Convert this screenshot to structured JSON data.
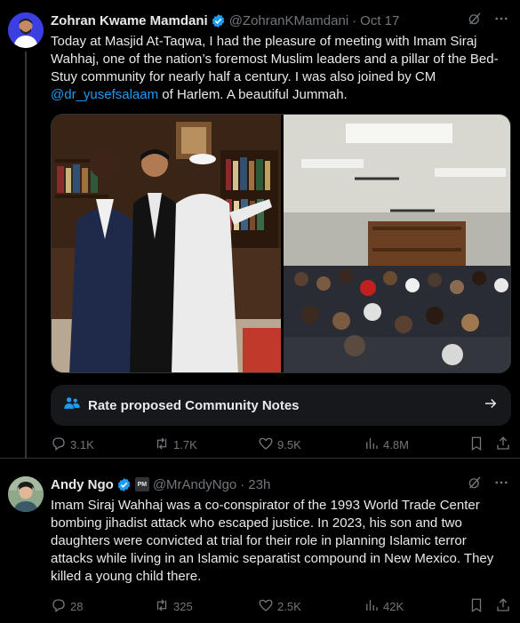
{
  "posts": [
    {
      "author_name": "Zohran Kwame Mamdani",
      "handle": "@ZohranKMamdani",
      "dot": "·",
      "time": "Oct 17",
      "text_before": "Today at Masjid At-Taqwa, I had the pleasure of meeting with Imam Siraj Wahhaj, one of the nation’s foremost Muslim leaders and a pillar of the Bed-Stuy community for nearly half a century. I was also joined by CM ",
      "mention": "@dr_yusefsalaam",
      "text_after": " of Harlem. A beautiful Jummah.",
      "community_notes_label": "Rate proposed Community Notes",
      "replies": "3.1K",
      "reposts": "1.7K",
      "likes": "9.5K",
      "views": "4.8M"
    },
    {
      "author_name": "Andy Ngo",
      "affiliate_badge": "PM",
      "handle": "@MrAndyNgo",
      "dot": "·",
      "time": "23h",
      "text": "Imam Siraj Wahhaj was a co-conspirator of the 1993 World Trade Center bombing jihadist attack who escaped justice. In 2023, his son and two daughters were convicted at trial for their role in planning Islamic terror attacks while living in an Islamic separatist compound in New Mexico. They killed a young child there.",
      "replies": "28",
      "reposts": "325",
      "likes": "2.5K",
      "views": "42K"
    }
  ],
  "icons": {
    "verified": "verified-badge-icon",
    "grok": "grok-icon",
    "more": "more-icon",
    "community_notes": "people-icon",
    "arrow": "arrow-right-icon",
    "reply": "reply-icon",
    "repost": "repost-icon",
    "like": "heart-icon",
    "views": "views-icon",
    "bookmark": "bookmark-icon",
    "share": "share-icon"
  },
  "colors": {
    "background": "#000000",
    "text": "#e7e9ea",
    "muted": "#71767b",
    "link": "#1d9bf0",
    "verified": "#1d9bf0"
  }
}
